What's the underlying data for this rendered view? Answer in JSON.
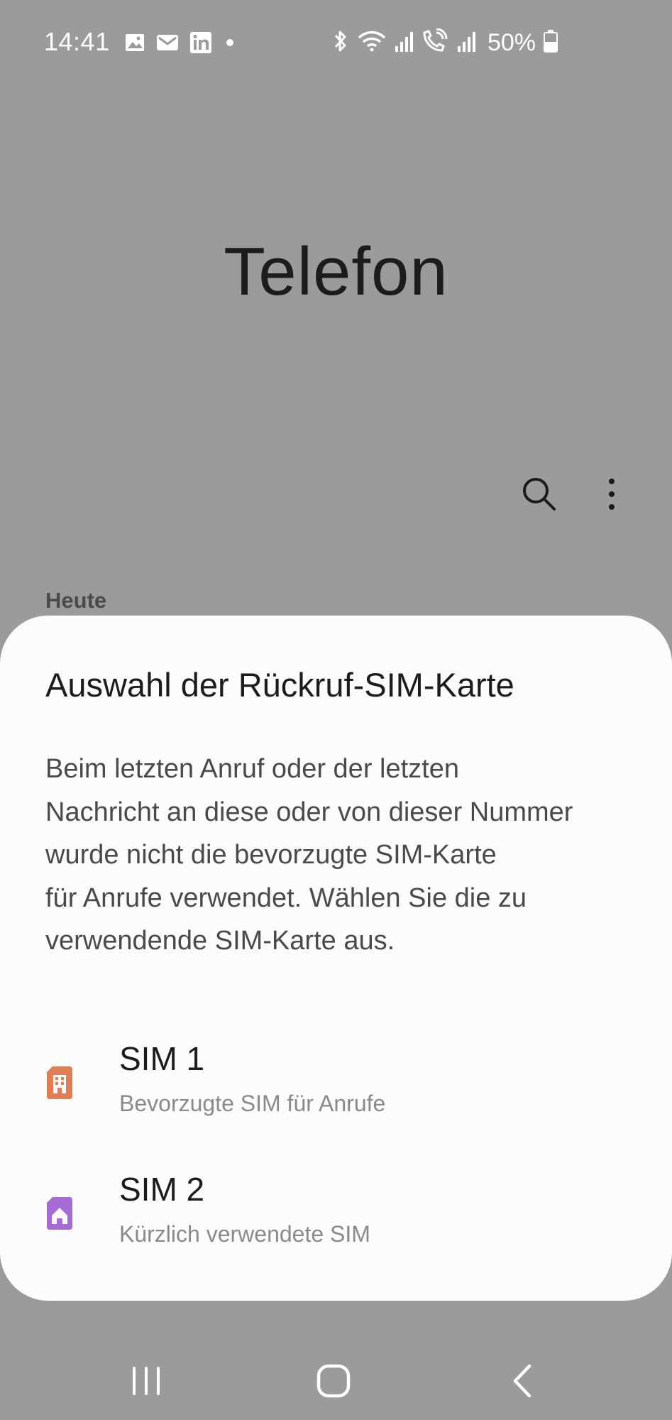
{
  "status_bar": {
    "time": "14:41",
    "battery": "50%",
    "notification_icons": [
      "image-icon",
      "mail-icon",
      "linkedin-icon",
      "dot-icon"
    ],
    "system_icons": [
      "bluetooth-icon",
      "wifi-icon",
      "signal-sim1-icon",
      "wifi-call-icon",
      "signal-sim2-icon",
      "battery-icon"
    ]
  },
  "app": {
    "title": "Telefon",
    "section_label": "Heute"
  },
  "dialog": {
    "title": "Auswahl der Rückruf-SIM-Karte",
    "body_lines": [
      "Beim letzten Anruf oder der letzten",
      "Nachricht an diese oder von dieser Nummer",
      "wurde nicht die bevorzugte SIM-Karte",
      "für Anrufe verwendet. Wählen Sie die zu",
      "verwendende SIM-Karte aus."
    ],
    "options": [
      {
        "name": "SIM 1",
        "description": "Bevorzugte SIM für Anrufe",
        "icon": "sim-building-icon",
        "color": "#e07e55"
      },
      {
        "name": "SIM 2",
        "description": "Kürzlich verwendete SIM",
        "icon": "sim-home-icon",
        "color": "#a76bd4"
      }
    ]
  },
  "nav_bar": {
    "buttons": [
      "recents-icon",
      "home-icon",
      "back-icon"
    ]
  }
}
